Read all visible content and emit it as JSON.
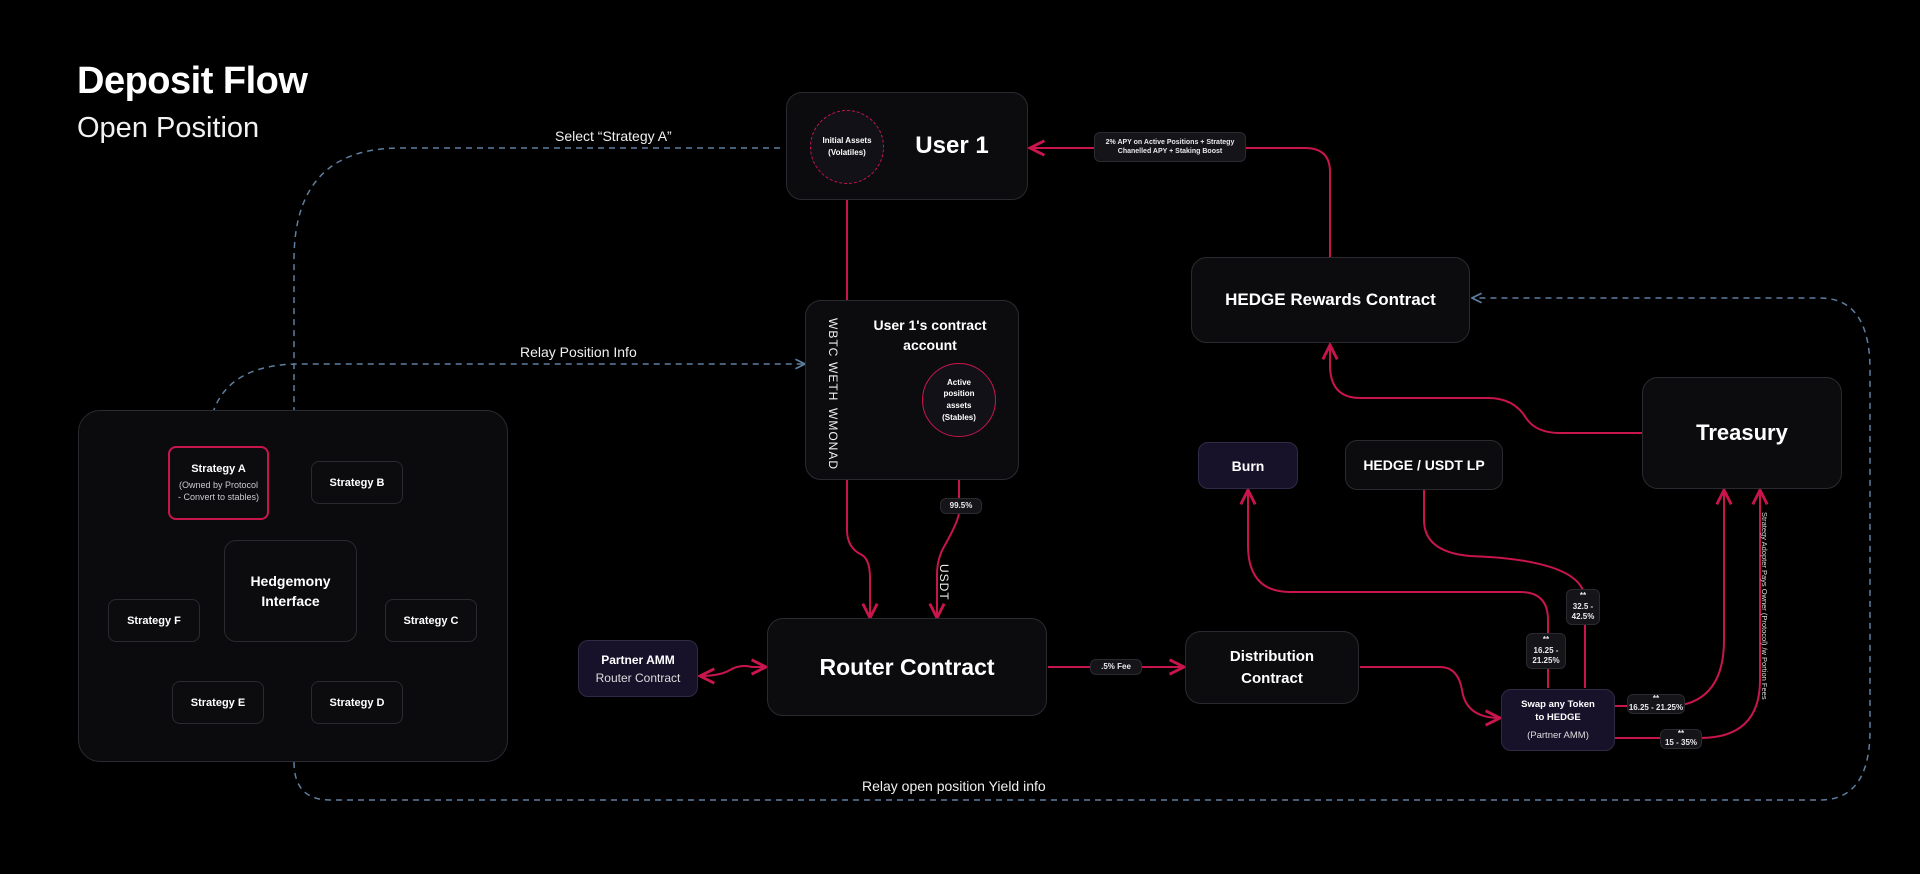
{
  "header": {
    "title": "Deposit Flow",
    "subtitle": "Open Position"
  },
  "colors": {
    "flow": "#c8164c",
    "info": "#5e7ea0",
    "node_bg": "#0c0c0f",
    "node_purple_bg": "#17122a"
  },
  "nodes": {
    "user1": {
      "label": "User 1",
      "circle": "Initial Assets (Volatiles)"
    },
    "contract_account": {
      "label": "User 1's contract account",
      "tokens": [
        "WBTC",
        "WETH",
        "WMONAD"
      ],
      "circle": "Active position assets (Stables)"
    },
    "router": {
      "label": "Router Contract"
    },
    "partner_amm": {
      "label": "Partner AMM",
      "sublabel": "Router Contract"
    },
    "distribution": {
      "label": "Distribution Contract"
    },
    "swap": {
      "label": "Swap any Token to HEDGE",
      "sublabel": "(Partner AMM)"
    },
    "burn": {
      "label": "Burn"
    },
    "lp": {
      "label": "HEDGE / USDT LP"
    },
    "treasury": {
      "label": "Treasury"
    },
    "rewards": {
      "label": "HEDGE Rewards Contract"
    },
    "interface": {
      "label": "Hedgemony Interface"
    },
    "strategies": [
      {
        "label": "Strategy A",
        "sublabel": "(Owned by Protocol - Convert to stables)"
      },
      {
        "label": "Strategy B"
      },
      {
        "label": "Strategy C"
      },
      {
        "label": "Strategy D"
      },
      {
        "label": "Strategy E"
      },
      {
        "label": "Strategy F"
      }
    ]
  },
  "edges": {
    "select_strategy": "Select “Strategy A”",
    "relay_position": "Relay Position Info",
    "relay_yield": "Relay open position Yield info",
    "usdt": "USDT",
    "pct_99_5": "99.5%",
    "fee": ".5% Fee",
    "apy_note": "2% APY on Active Positions + Strategy Chanelled APY + Staking Boost",
    "burn_share": {
      "mark": "**",
      "value": "16.25 - 21.25%"
    },
    "lp_share": {
      "mark": "**",
      "value": "32.5 - 42.5%"
    },
    "treasury_share_1": {
      "mark": "**",
      "value": "16.25 - 21.25%"
    },
    "treasury_share_2": {
      "mark": "**",
      "value": "15 - 35%"
    },
    "adopter_fees": "Strategy Adopter Pays Owner (Protocol) /w Portion Fees"
  }
}
